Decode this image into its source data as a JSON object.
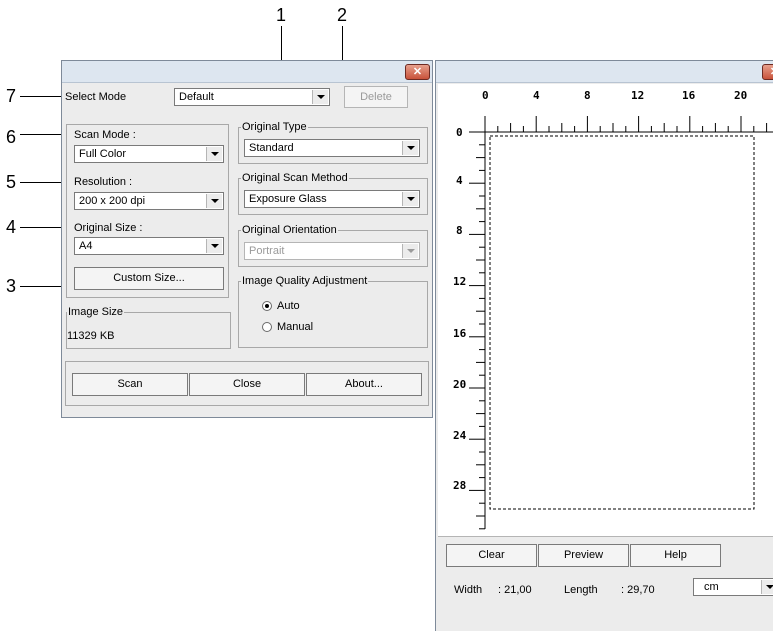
{
  "callouts": [
    {
      "id": "1",
      "label": "1"
    },
    {
      "id": "2",
      "label": "2"
    },
    {
      "id": "3",
      "label": "3"
    },
    {
      "id": "4",
      "label": "4"
    },
    {
      "id": "5",
      "label": "5"
    },
    {
      "id": "6",
      "label": "6"
    },
    {
      "id": "7",
      "label": "7"
    }
  ],
  "main_window": {
    "close_glyph": "✕",
    "select_mode_label": "Select Mode",
    "select_mode_value": "Default",
    "delete_label": "Delete",
    "scan_mode_label": "Scan Mode :",
    "scan_mode_value": "Full Color",
    "resolution_label": "Resolution :",
    "resolution_value": "200 x 200 dpi",
    "original_size_label": "Original Size :",
    "original_size_value": "A4",
    "custom_size_label": "Custom Size...",
    "image_size_label": "Image Size",
    "image_size_value": "11329 KB",
    "original_type_label": "Original Type",
    "original_type_value": "Standard",
    "scan_method_label": "Original Scan Method",
    "scan_method_value": "Exposure Glass",
    "orientation_label": "Original Orientation",
    "orientation_value": "Portrait",
    "quality_label": "Image Quality Adjustment",
    "quality_auto_label": "Auto",
    "quality_manual_label": "Manual",
    "quality_selected": "Auto",
    "scan_label": "Scan",
    "close_label": "Close",
    "about_label": "About..."
  },
  "preview_window": {
    "close_glyph": "✕",
    "ruler_top_labels": [
      "0",
      "4",
      "8",
      "12",
      "16",
      "20"
    ],
    "ruler_left_labels": [
      "0",
      "4",
      "8",
      "12",
      "16",
      "20",
      "24",
      "28"
    ],
    "clear_label": "Clear",
    "preview_label": "Preview",
    "help_label": "Help",
    "width_label": "Width",
    "width_value": ": 21,00",
    "length_label": "Length",
    "length_value": ": 29,70",
    "unit_value": "cm"
  }
}
